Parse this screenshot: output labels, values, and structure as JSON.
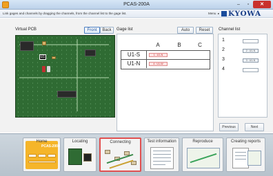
{
  "window": {
    "title": "PCAS-200A",
    "controls": {
      "minimize": "–",
      "maximize": "▫",
      "close": "✕"
    }
  },
  "header": {
    "instruction": "Link gages and channels by dragging the channels, from the channel list to the gage list.",
    "menu_label": "Menu",
    "menu_arrow": "▸",
    "logo": "KYOWA"
  },
  "pcb_panel": {
    "title": "Virtual PCB",
    "front_label": "Front",
    "back_label": "Back",
    "active_side": "Front",
    "chip_label": "U1"
  },
  "gage_panel": {
    "title": "Gage list",
    "auto_label": "Auto",
    "reset_label": "Reset",
    "columns": [
      "A",
      "B",
      "C"
    ],
    "rows": [
      {
        "name": "U1-S",
        "link": "1 : U1-N"
      },
      {
        "name": "U1-N",
        "link": "4 : U1-W"
      }
    ]
  },
  "channel_panel": {
    "title": "Channel list",
    "channels": [
      {
        "number": "1",
        "assigned": ""
      },
      {
        "number": "2",
        "assigned": "2 : U1-N"
      },
      {
        "number": "3",
        "assigned": "3 : U1-N"
      },
      {
        "number": "4",
        "assigned": ""
      }
    ],
    "previous_label": "Previous",
    "next_label": "Next"
  },
  "workflow": {
    "steps": [
      {
        "label": "Home",
        "sub": "PCAS-200A"
      },
      {
        "label": "Locating"
      },
      {
        "label": "Connecting"
      },
      {
        "label": "Test information"
      },
      {
        "label": "Reproduce"
      },
      {
        "label": "Creating reports"
      }
    ],
    "active_step": "Connecting"
  },
  "colors": {
    "accent": "#1a3f88",
    "active_border": "#e05050",
    "pcb_green": "#2f6b33",
    "home_orange": "#f5b52a",
    "link_red": "#c02020"
  }
}
